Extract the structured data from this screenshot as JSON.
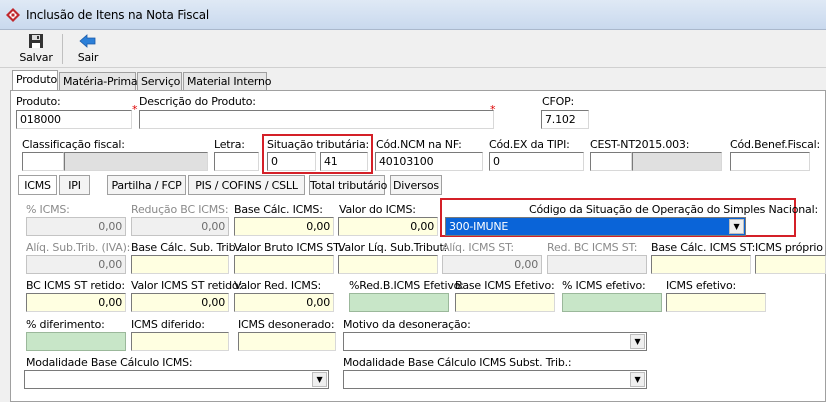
{
  "window": {
    "title": "Inclusão de Itens na Nota Fiscal",
    "brand_color": "#c0282d"
  },
  "toolbar": {
    "save_label": "Salvar",
    "exit_label": "Sair"
  },
  "tabs": [
    "Produto",
    "Matéria-Prima",
    "Serviço",
    "Material Interno"
  ],
  "produto": {
    "produto_label": "Produto:",
    "produto_value": "018000",
    "descricao_label": "Descrição do Produto:",
    "descricao_value": "",
    "cfop_label": "CFOP:",
    "cfop_value": "7.102",
    "classificacao_label": "Classificação fiscal:",
    "letra_label": "Letra:",
    "situacao_label": "Situação tributária:",
    "situacao_value1": "0",
    "situacao_value2": "41",
    "ncm_label": "Cód.NCM na NF:",
    "ncm_value": "40103100",
    "ex_tipi_label": "Cód.EX da TIPI:",
    "ex_tipi_value": "0",
    "cest_label": "CEST-NT2015.003:",
    "benef_label": "Cód.Benef.Fiscal:"
  },
  "subtabs": [
    "ICMS",
    "IPI",
    "Partilha / FCP",
    "PIS / COFINS / CSLL",
    "Total tributário",
    "Diversos"
  ],
  "icms": {
    "pct_icms_label": "% ICMS:",
    "pct_icms_value": "0,00",
    "reducao_bc_label": "Redução BC ICMS:",
    "reducao_bc_value": "0,00",
    "base_calc_label": "Base Cálc. ICMS:",
    "base_calc_value": "0,00",
    "valor_icms_label": "Valor do ICMS:",
    "valor_icms_value": "0,00",
    "csosn_label": "Código da Situação de Operação do Simples Nacional:",
    "csosn_value": "300-IMUNE",
    "aliq_sub_label": "Alíq. Sub.Trib. (IVA):",
    "aliq_sub_value": "0,00",
    "base_sub_label": "Base Cálc. Sub. Trib.:",
    "valor_bruto_st_label": "Valor Bruto ICMS ST:",
    "valor_liq_sub_label": "Valor Líq. Sub.Tribut:",
    "aliq_icms_st_label": "Alíq. ICMS ST:",
    "aliq_icms_st_value": "0,00",
    "red_bc_st_label": "Red. BC ICMS ST:",
    "base_calc_st_label": "Base Cálc. ICMS ST:",
    "icms_proprio_label": "ICMS próprio S",
    "bc_retido_label": "BC ICMS ST retido:",
    "bc_retido_value": "0,00",
    "valor_retido_label": "Valor ICMS ST retido:",
    "valor_retido_value": "0,00",
    "valor_red_label": "Valor Red. ICMS:",
    "valor_red_value": "0,00",
    "red_b_efetivo_label": "%Red.B.ICMS Efetivo:",
    "base_efetivo_label": "Base ICMS Efetivo:",
    "pct_efetivo_label": "% ICMS efetivo:",
    "icms_efetivo_label": "ICMS efetivo:",
    "diferimento_label": "% diferimento:",
    "diferido_label": "ICMS diferido:",
    "desonerado_label": "ICMS desonerado:",
    "motivo_label": "Motivo da desoneração:",
    "modalidade_label": "Modalidade Base Cálculo ICMS:",
    "modalidade_st_label": "Modalidade Base Cálculo ICMS Subst. Trib.:"
  }
}
